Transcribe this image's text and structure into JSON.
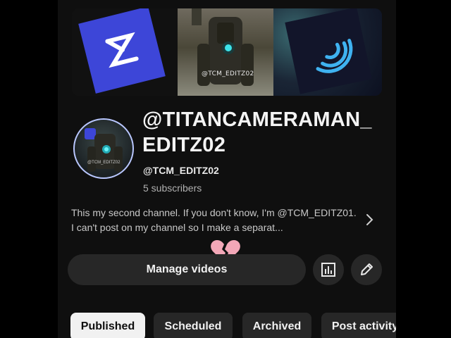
{
  "banner": {
    "middle_watermark": "@TCM_EDITZ02",
    "left_logo": "capcut-logo",
    "right_logo": "alight-motion-logo"
  },
  "channel": {
    "avatar_watermark": "@TCM_EDITZ02",
    "name": "@TITANCAMERAMAN_EDITZ02",
    "handle": "@TCM_EDITZ02",
    "subscribers": "5 subscribers",
    "description": "This my second channel. If you don't know, I'm @TCM_EDITZ01. I can't post on my channel so I make a separat...",
    "overlay_emoji": "broken-heart-icon"
  },
  "actions": {
    "manage_videos": "Manage videos",
    "analytics_icon": "bar-chart-icon",
    "edit_icon": "pencil-icon"
  },
  "tabs": [
    {
      "label": "Published",
      "active": true
    },
    {
      "label": "Scheduled",
      "active": false
    },
    {
      "label": "Archived",
      "active": false
    },
    {
      "label": "Post activity",
      "active": false
    }
  ],
  "colors": {
    "background": "#0f0f0f",
    "surface": "#272727",
    "active_tab": "#f1f1f1",
    "capcut_blue": "#3d46d8",
    "broken_heart": "#f2a7b7"
  }
}
